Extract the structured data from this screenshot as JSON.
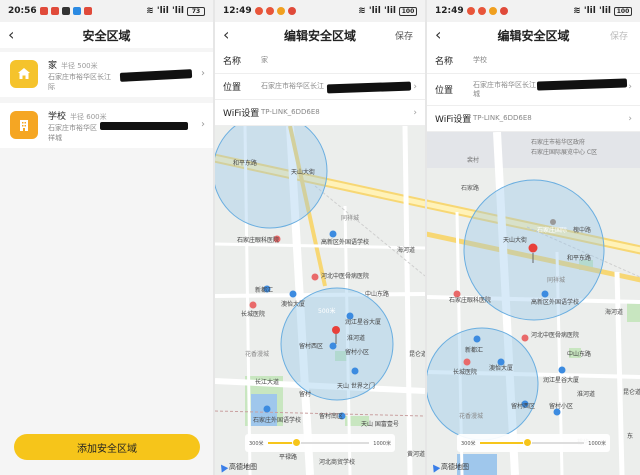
{
  "panel1": {
    "status": {
      "time": "20:56",
      "signal": "'lil 'lil",
      "battery": "73"
    },
    "title": "安全区域",
    "zones": [
      {
        "name": "家",
        "radius": "半径 500米",
        "address_line1": "石家庄市裕华区长江",
        "address_line2": "际"
      },
      {
        "name": "学校",
        "radius": "半径 600米",
        "address_line1": "石家庄市裕华区",
        "address_line2": "祥城"
      }
    ],
    "add_button": "添加安全区域"
  },
  "panel2": {
    "status": {
      "time": "12:49",
      "signal": "'lil 'lil",
      "battery": "100"
    },
    "title": "编辑安全区域",
    "save": "保存",
    "name_label": "名称",
    "name_value": "家",
    "location_label": "位置",
    "location_value": "石家庄市裕华区长江",
    "wifi_label": "WiFi设置",
    "wifi_value": "TP-LINK_6DD6E8",
    "circle_label": "500米",
    "slider_min": "300米",
    "slider_max": "1000米",
    "slider_fraction": 0.28,
    "map_logo": "高德地图",
    "map_labels": {
      "road1": "和平东路",
      "road2": "天山大街",
      "poi1": "石家庄眼科医院",
      "poi2": "高新区外国语学校",
      "poi3": "同祥城",
      "poi4": "海河道",
      "poi5": "河北中医骨病医院",
      "poi6": "新都汇",
      "poi7": "中山东路",
      "poi8": "澳怡大厦",
      "poi9": "长城医院",
      "poi10": "润江星谷大厦",
      "poi11": "留村西区",
      "poi12": "留村小区",
      "poi13": "淮河道",
      "poi14": "花香漫城",
      "poi15": "长江大道",
      "poi16": "天山 世界之门",
      "poi17": "留村",
      "poi18": "石家庄外国语学校",
      "poi19": "留村南区",
      "poi20": "昆仑道",
      "poi21": "天山 国富壹号",
      "poi22": "平禄路",
      "poi23": "河北商贸学校",
      "poi24": "黄河道"
    }
  },
  "panel3": {
    "status": {
      "time": "12:49",
      "signal": "'lil 'lil",
      "battery": "100"
    },
    "title": "编辑安全区域",
    "save": "保存",
    "name_label": "名称",
    "name_value": "学校",
    "location_label": "位置",
    "location_value_line1": "石家庄市裕华区长江",
    "location_value_line2": "城",
    "wifi_label": "WiFi设置",
    "wifi_value": "TP-LINK_6DD6E8",
    "slider_min": "300米",
    "slider_max": "1000米",
    "slider_fraction": 0.45,
    "map_logo": "高德地图",
    "map_labels": {
      "road1": "石家庄市裕华区政府",
      "road2": "石家庄国际展览中心 C区",
      "road3": "石家路",
      "road4": "槐中路",
      "road5": "石家庄国际",
      "road6": "和平东路",
      "poi1": "天山大街",
      "poi2": "同祥城",
      "poi3": "石家庄眼科医院",
      "poi4": "高新区外国语学校",
      "poi5": "海河道",
      "poi6": "河北中医骨病医院",
      "poi7": "新都汇",
      "poi8": "中山东路",
      "poi9": "长城医院",
      "poi10": "澳怡大厦",
      "poi11": "润江星谷大厦",
      "poi12": "花香漫城",
      "poi13": "留村西区",
      "poi14": "留村小区",
      "poi15": "裕华",
      "poi16": "昆仑道",
      "poi17": "淮河道",
      "poi18": "东",
      "poi19": "裴村"
    }
  }
}
